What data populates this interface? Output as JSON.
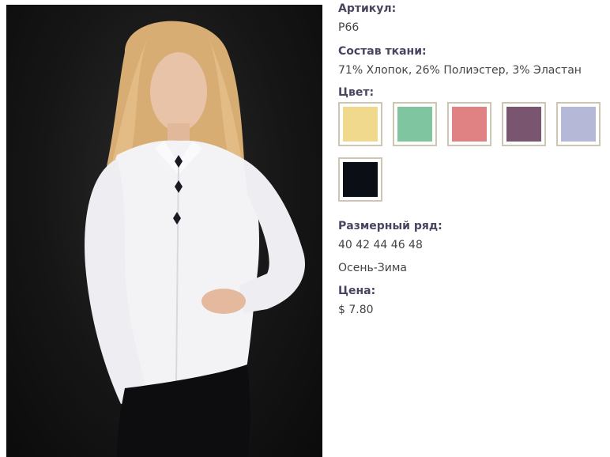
{
  "product": {
    "article_label": "Артикул:",
    "article_value": "P66",
    "fabric_label": "Состав ткани:",
    "fabric_value": "71% Хлопок, 26% Полиэстер, 3% Эластан",
    "color_label": "Цвет:",
    "colors": [
      {
        "name": "yellow-swatch",
        "hex": "#f0d98c"
      },
      {
        "name": "mint-swatch",
        "hex": "#7fc6a0"
      },
      {
        "name": "pink-swatch",
        "hex": "#e08183"
      },
      {
        "name": "plum-swatch",
        "hex": "#7a5570"
      },
      {
        "name": "lavender-swatch",
        "hex": "#b5b8d6"
      },
      {
        "name": "black-swatch",
        "hex": "#0b0e14"
      }
    ],
    "sizes_label": "Размерный ряд:",
    "sizes_value": "40 42 44 46 48",
    "season_value": "Осень-Зима",
    "price_label": "Цена:",
    "price_value": "$ 7.80"
  },
  "colors": {
    "label_text": "#4a4460",
    "value_text": "#444444",
    "swatch_border": "#cdc6b2"
  }
}
